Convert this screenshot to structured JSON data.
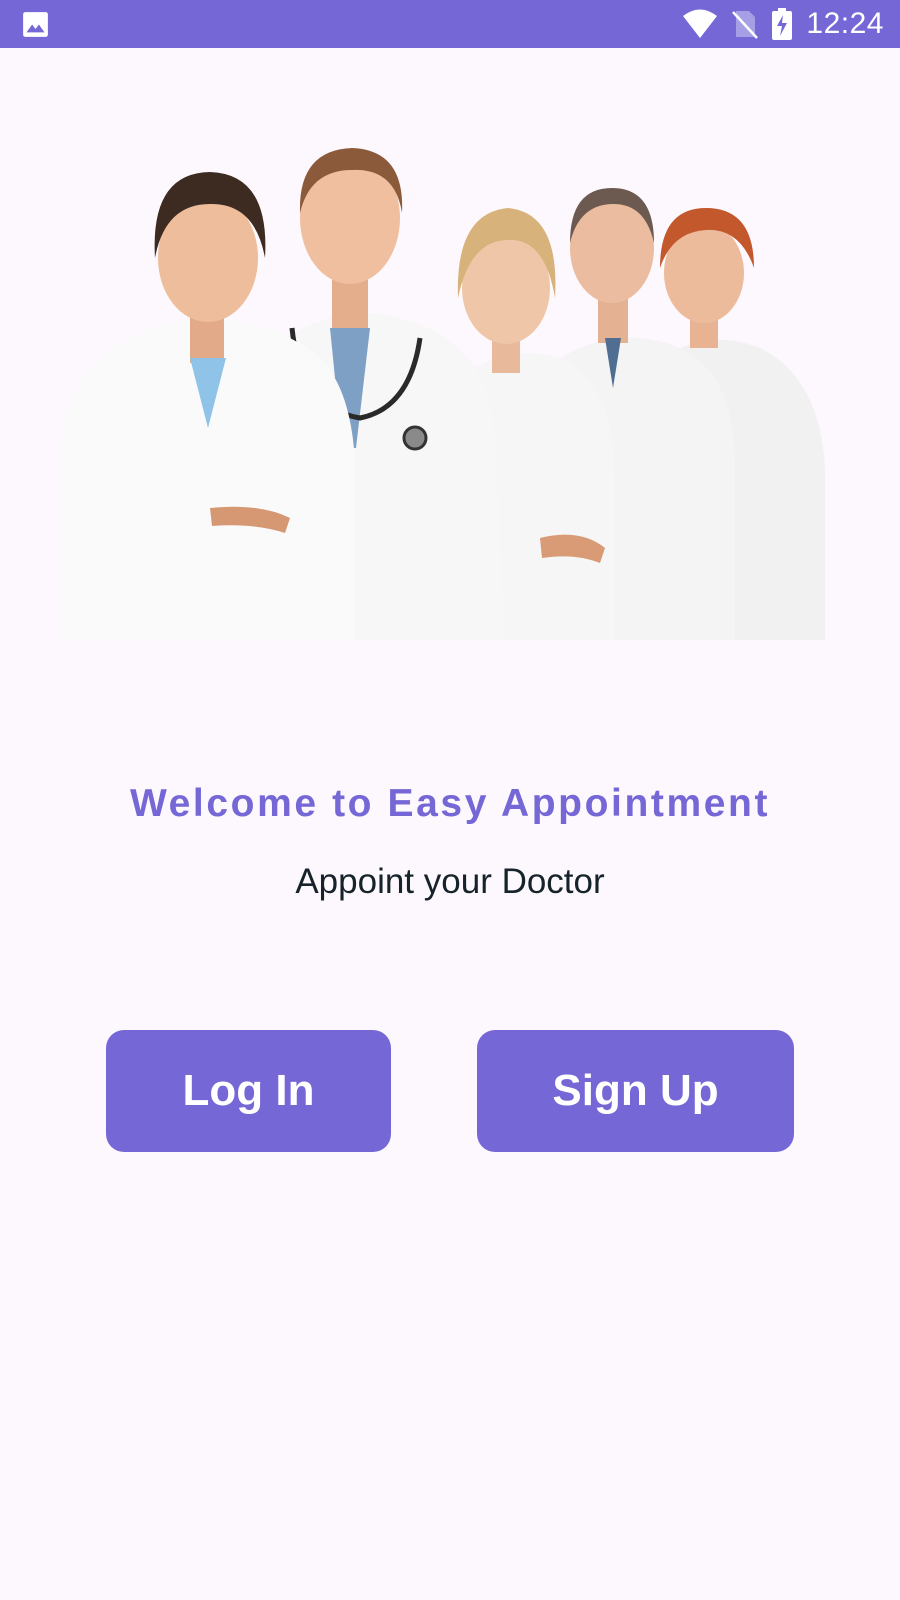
{
  "status_bar": {
    "time": "12:24",
    "left_icon": "image-notification-icon",
    "icons": [
      "wifi-icon",
      "no-sim-icon",
      "battery-charging-icon"
    ],
    "color": "#7567d6"
  },
  "hero": {
    "icon": "doctors-group-image"
  },
  "welcome": {
    "title": "Welcome to Easy Appointment",
    "subtitle": "Appoint your Doctor"
  },
  "actions": {
    "login_label": "Log In",
    "signup_label": "Sign Up"
  },
  "colors": {
    "accent": "#7567d6",
    "background": "#fdf8fd",
    "subtitle_text": "#17232b"
  }
}
